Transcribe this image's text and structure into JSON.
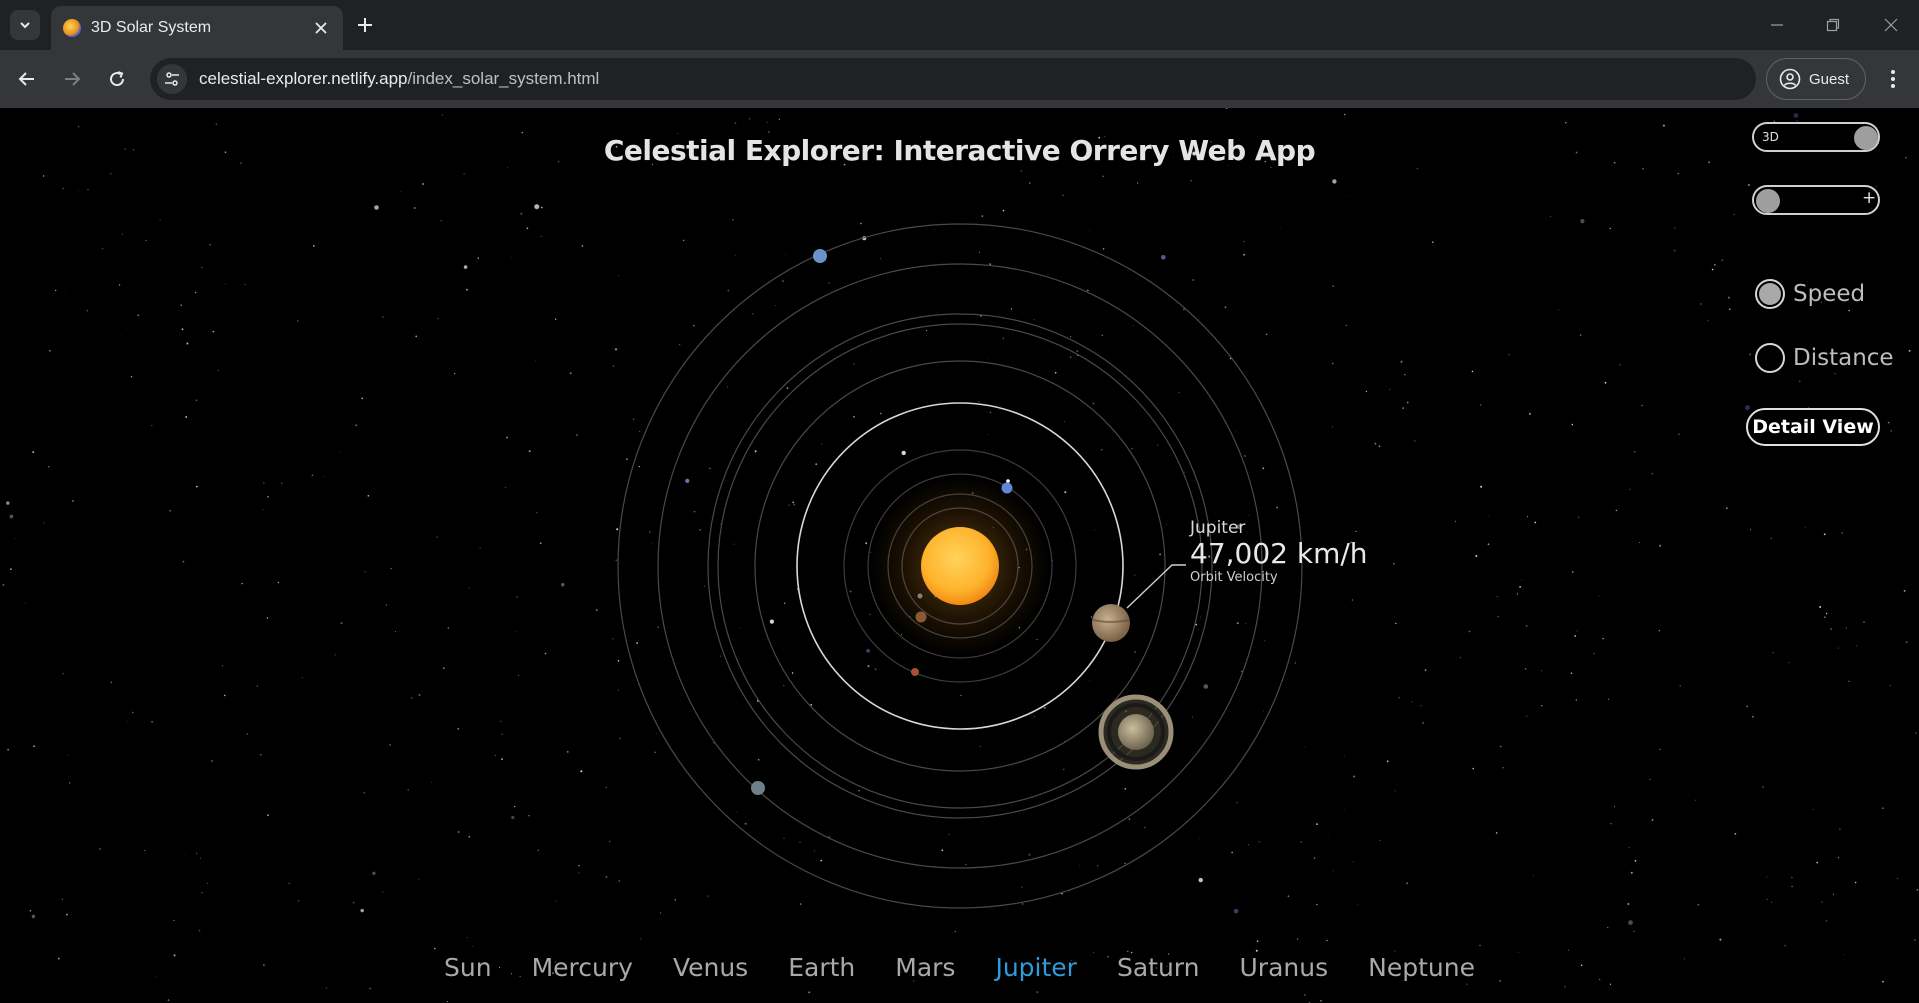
{
  "browser": {
    "tab_title": "3D Solar System",
    "url_host": "celestial-explorer.netlify.app",
    "url_path": "/index_solar_system.html",
    "profile_label": "Guest"
  },
  "app": {
    "title": "Celestial Explorer: Interactive Orrery Web App",
    "callout": {
      "planet": "Jupiter",
      "value": "47,002 km/h",
      "caption": "Orbit Velocity"
    },
    "controls": {
      "toggle_3d_label": "3D",
      "zoom_plus_label": "+",
      "speed_label": "Speed",
      "distance_label": "Distance",
      "speed_selected": true,
      "distance_selected": false,
      "detail_button": "Detail View"
    },
    "planets": [
      {
        "label": "Sun",
        "active": false
      },
      {
        "label": "Mercury",
        "active": false
      },
      {
        "label": "Venus",
        "active": false
      },
      {
        "label": "Earth",
        "active": false
      },
      {
        "label": "Mars",
        "active": false
      },
      {
        "label": "Jupiter",
        "active": true
      },
      {
        "label": "Saturn",
        "active": false
      },
      {
        "label": "Uranus",
        "active": false
      },
      {
        "label": "Neptune",
        "active": false
      }
    ]
  },
  "colors": {
    "active_planet": "#2e9cda",
    "sun": "#ffb32c",
    "background": "#000000"
  }
}
